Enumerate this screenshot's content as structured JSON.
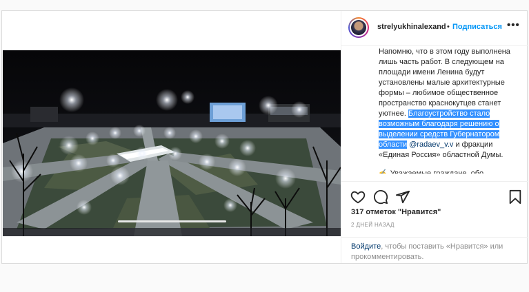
{
  "post": {
    "username": "strelyukhinalexand",
    "separator": "•",
    "follow_label": "Подписаться",
    "more_label": "•••",
    "caption": {
      "text_plain": "Напомню, что в этом году выполнена лишь часть работ. В следующем на площади имени Ленина будут установлены малые архитектурные формы – любимое общественное пространство краснокутцев станет уютнее. ",
      "text_highlighted": "Благоустройство стало возможным благодаря решению о выделении средств Губернатором области",
      "mention": "@radaev_v.v",
      "text_after": " и фракции «Единая Россия» областной Думы.",
      "cut_line": "✍ Уважаемые граждане, обо"
    },
    "likes_label": "317 отметок \"Нравится\"",
    "date_label": "2 ДНЕЙ НАЗАД",
    "login_link": "Войдите",
    "login_text": ", чтобы поставить «Нравится» или прокомментировать."
  },
  "icons": {
    "like": "heart-outline-icon",
    "comment": "speech-bubble-icon",
    "share": "paper-plane-icon",
    "save": "bookmark-icon",
    "more": "ellipsis-icon"
  },
  "colors": {
    "link_blue": "#0095f6",
    "mention_blue": "#00376b",
    "selection": "#3390ff",
    "muted": "#8e8e8e"
  }
}
